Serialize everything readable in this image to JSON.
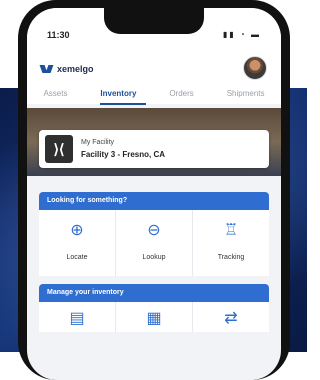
{
  "status_bar": {
    "time": "11:30",
    "icons": "▮▮ ◔ ▬"
  },
  "app": {
    "name": "xemelgo"
  },
  "tabs": [
    {
      "label": "Assets"
    },
    {
      "label": "Inventory"
    },
    {
      "label": "Orders"
    },
    {
      "label": "Shipments"
    }
  ],
  "facility": {
    "label": "My Facility",
    "name": "Facility 3 - Fresno, CA",
    "icon": "facility-logo-icon"
  },
  "sections": {
    "search": {
      "title": "Looking for something?",
      "tiles": [
        {
          "label": "Locate",
          "icon": "locate-icon",
          "glyph": "⊕"
        },
        {
          "label": "Lookup",
          "icon": "lookup-icon",
          "glyph": "⊖"
        },
        {
          "label": "Tracking",
          "icon": "tracking-icon",
          "glyph": "♖"
        }
      ]
    },
    "manage": {
      "title": "Manage your inventory",
      "tiles": [
        {
          "icon": "clipboard-icon",
          "glyph": "▤"
        },
        {
          "icon": "calendar-icon",
          "glyph": "▦"
        },
        {
          "icon": "transfer-icon",
          "glyph": "⇄"
        }
      ]
    }
  },
  "colors": {
    "primary": "#2f6ed0",
    "brand": "#1d4f9a"
  }
}
